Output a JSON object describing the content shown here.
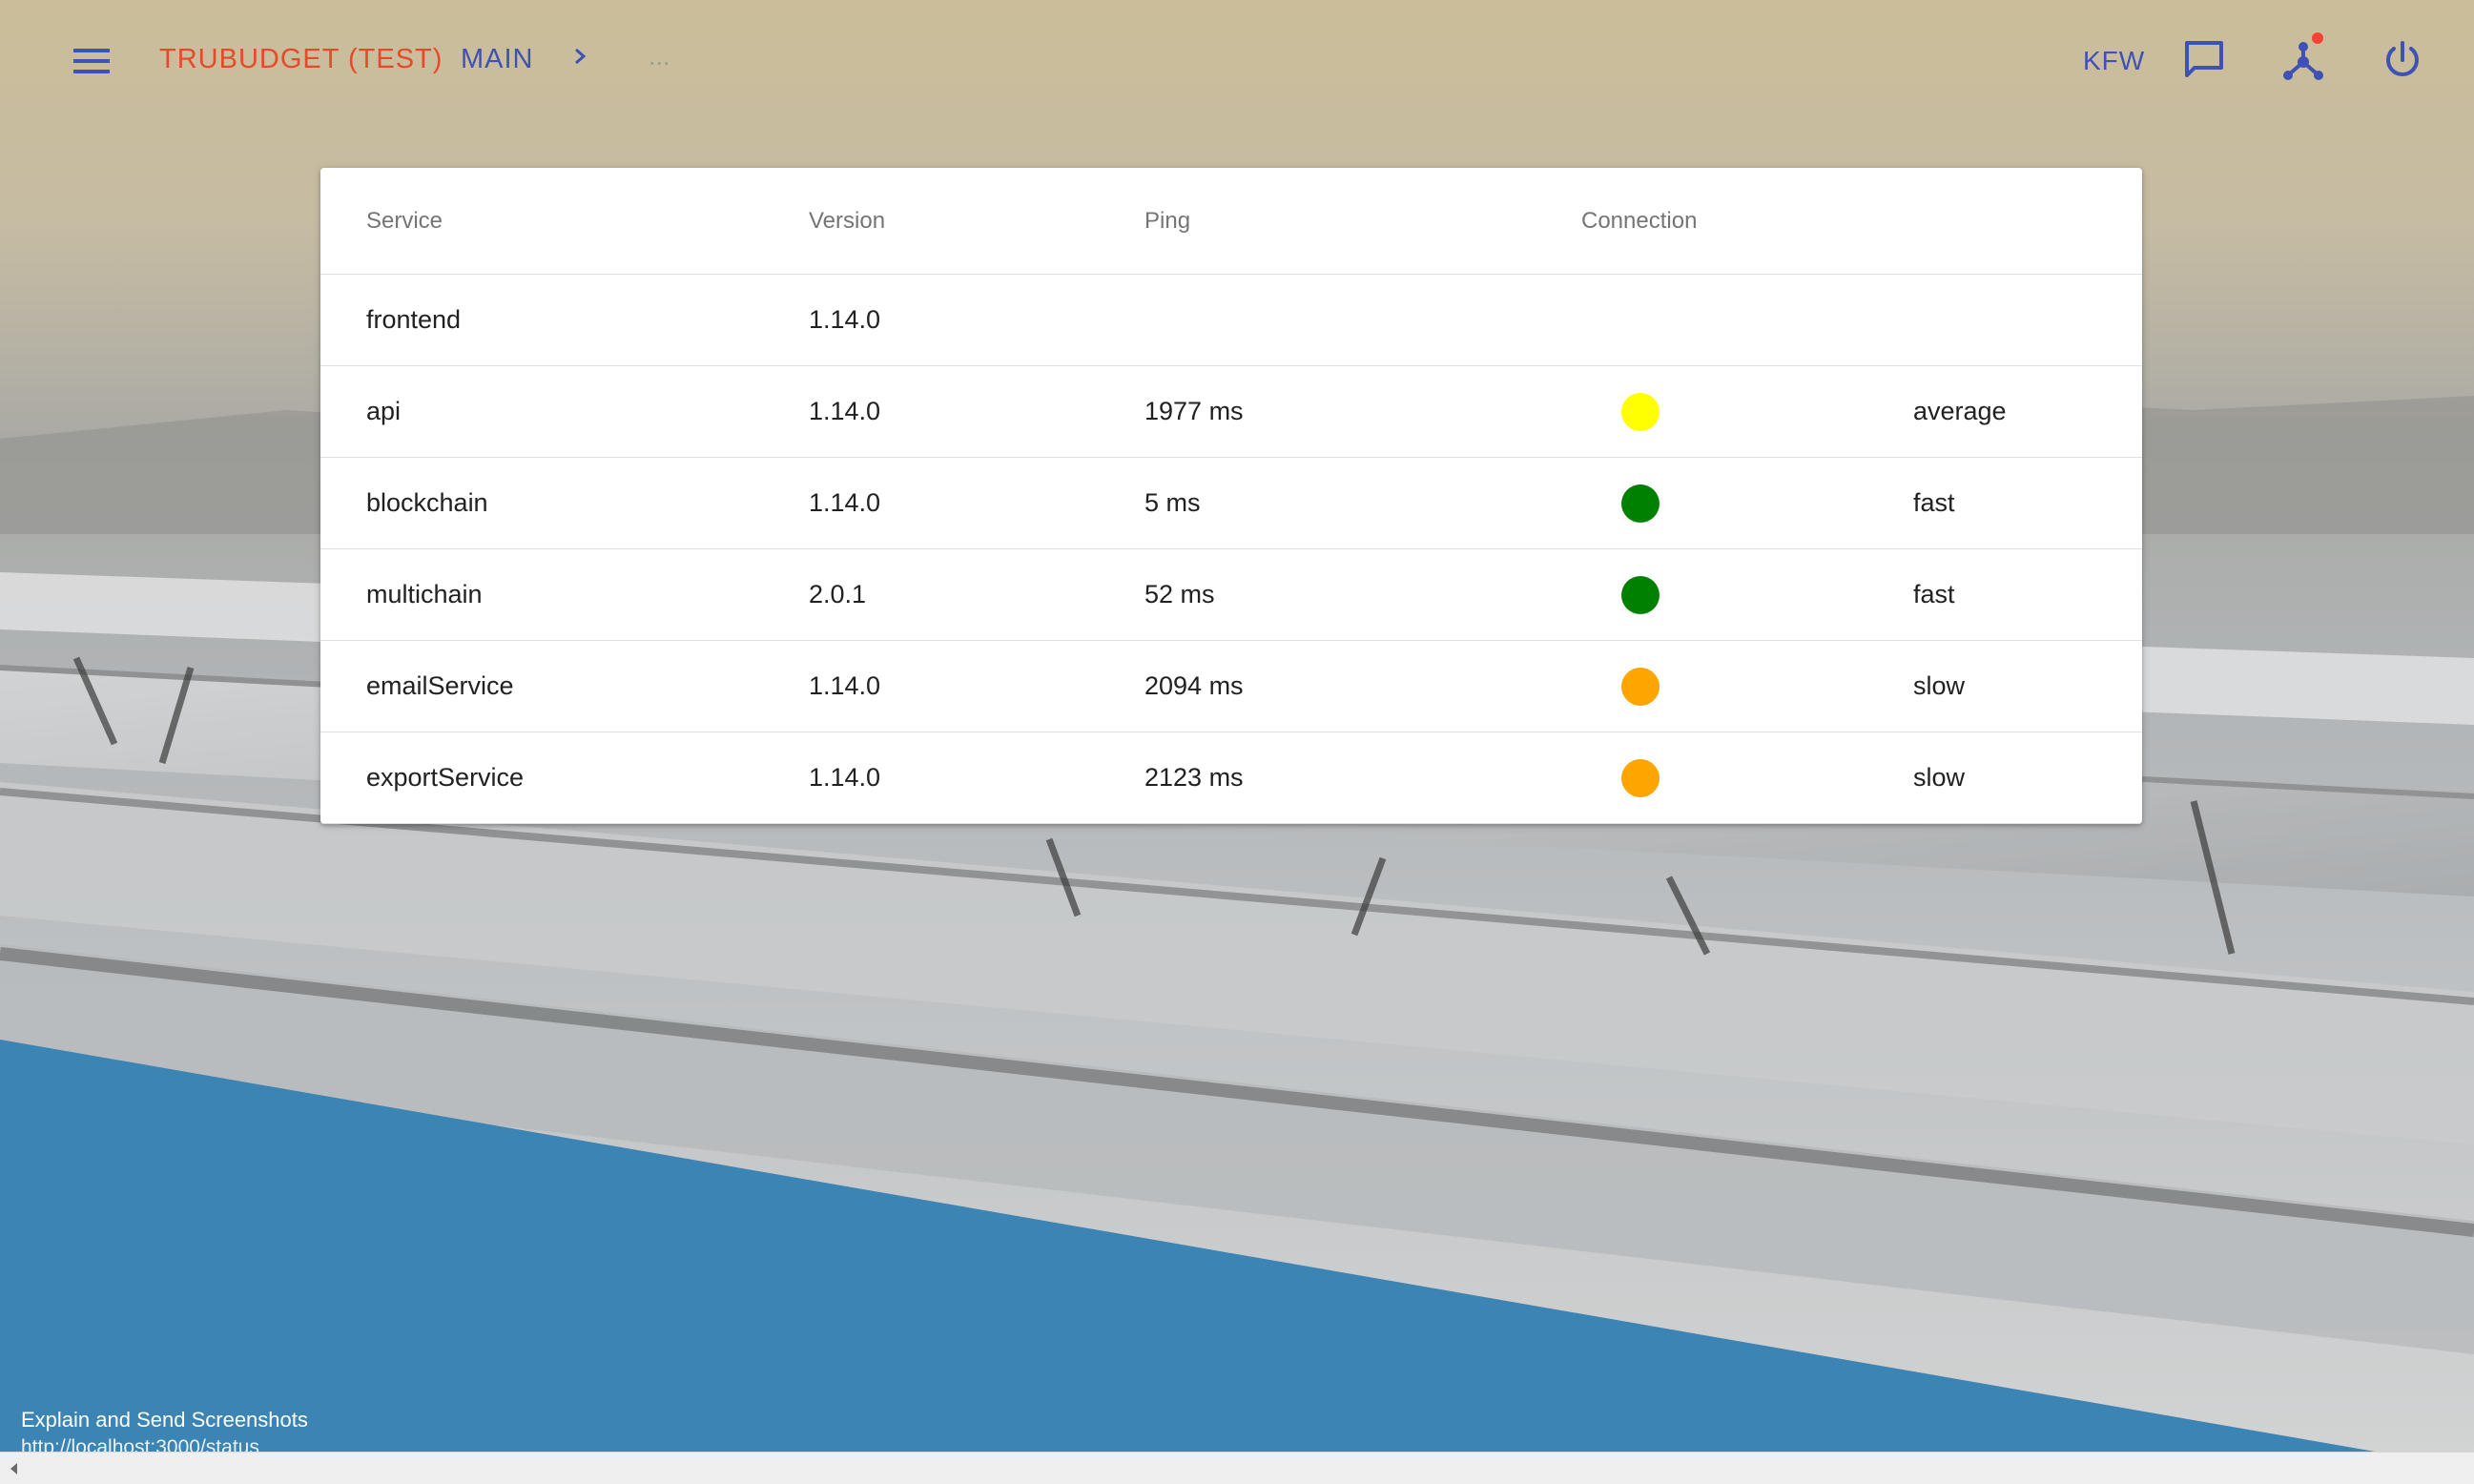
{
  "header": {
    "menu_icon": "hamburger-menu-icon",
    "brand": "TRUBUDGET (TEST)",
    "breadcrumb": {
      "main": "MAIN",
      "separator_icon": "chevron-right-icon",
      "ellipsis": "..."
    },
    "organization": "KFW",
    "actions": [
      {
        "name": "chat",
        "icon": "chat-bubble-icon"
      },
      {
        "name": "network",
        "icon": "network-icon",
        "has_notification_badge": true
      },
      {
        "name": "logout",
        "icon": "power-icon"
      }
    ],
    "accent_color": "#3f51b5",
    "brand_color": "#e8492a"
  },
  "status_table": {
    "columns": [
      "Service",
      "Version",
      "Ping",
      "Connection"
    ],
    "rows": [
      {
        "service": "frontend",
        "version": "1.14.0",
        "ping": "",
        "connection_color": "",
        "connection": ""
      },
      {
        "service": "api",
        "version": "1.14.0",
        "ping": "1977 ms",
        "connection_color": "#ffff00",
        "connection": "average"
      },
      {
        "service": "blockchain",
        "version": "1.14.0",
        "ping": "5 ms",
        "connection_color": "#008000",
        "connection": "fast"
      },
      {
        "service": "multichain",
        "version": "2.0.1",
        "ping": "52 ms",
        "connection_color": "#008000",
        "connection": "fast"
      },
      {
        "service": "emailService",
        "version": "1.14.0",
        "ping": "2094 ms",
        "connection_color": "#ffa500",
        "connection": "slow"
      },
      {
        "service": "exportService",
        "version": "1.14.0",
        "ping": "2123 ms",
        "connection_color": "#ffa500",
        "connection": "slow"
      }
    ]
  },
  "footer": {
    "feedback_link": "Explain and Send Screenshots",
    "status_url": "http://localhost:3000/status"
  }
}
